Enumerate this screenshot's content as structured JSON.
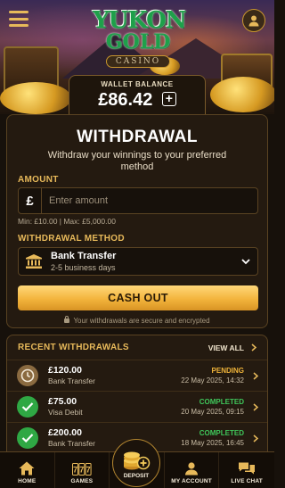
{
  "header": {
    "logo_line1": "YUKON",
    "logo_line2": "GOLD",
    "logo_line3": "CASINO",
    "wallet_label": "WALLET BALANCE",
    "wallet_amount": "£86.42",
    "wallet_add": "+"
  },
  "withdrawal": {
    "title": "WITHDRAWAL",
    "subtitle": "Withdraw your winnings to your preferred method",
    "amount_label": "AMOUNT",
    "currency_symbol": "£",
    "amount_placeholder": "Enter amount",
    "amount_value": "",
    "limits": "Min: £10.00 | Max: £5,000.00",
    "method_label": "WITHDRAWAL METHOD",
    "method_name": "Bank Transfer",
    "method_time": "2-5 business days",
    "cashout_label": "CASH OUT",
    "secure_note": "Your withdrawals are secure and encrypted"
  },
  "recent": {
    "title": "RECENT WITHDRAWALS",
    "view_all": "VIEW ALL",
    "items": [
      {
        "amount": "£120.00",
        "method": "Bank Transfer",
        "status": "PENDING",
        "date": "22 May 2025, 14:32",
        "icon": "clock-icon",
        "status_color": "#f0b43a"
      },
      {
        "amount": "£75.00",
        "method": "Visa Debit",
        "status": "COMPLETED",
        "date": "20 May 2025, 09:15",
        "icon": "check-icon",
        "status_color": "#3fc65a"
      },
      {
        "amount": "£200.00",
        "method": "Bank Transfer",
        "status": "COMPLETED",
        "date": "18 May 2025, 16:45",
        "icon": "check-icon",
        "status_color": "#3fc65a"
      }
    ]
  },
  "nav": {
    "home": "HOME",
    "games": "GAMES",
    "deposit": "DEPOSIT",
    "account": "MY ACCOUNT",
    "chat": "LIVE CHAT"
  },
  "colors": {
    "accent_gold": "#e7b95a",
    "pending": "#f0b43a",
    "completed": "#3fc65a"
  }
}
